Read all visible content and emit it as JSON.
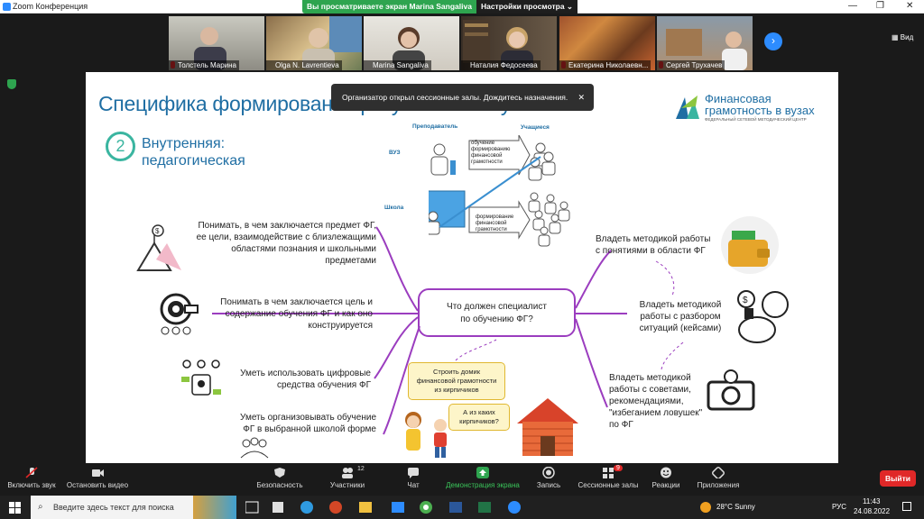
{
  "window": {
    "title": "Zoom Конференция"
  },
  "share_banner": {
    "message": "Вы просматриваете экран Marina Sangaliva",
    "options_label": "Настройки просмотра ⌄"
  },
  "gallery": {
    "participants": [
      {
        "name": "Толстель Марина",
        "muted": true
      },
      {
        "name": "Olga N. Lavrentieva",
        "muted": false
      },
      {
        "name": "Marina Sangaliva",
        "muted": false
      },
      {
        "name": "Наталия Федосеева",
        "muted": false
      },
      {
        "name": "Екатерина Николаевн...",
        "muted": true
      },
      {
        "name": "Сергей Трухачев",
        "muted": true
      }
    ],
    "view_label": "Вид"
  },
  "notification": {
    "text": "Организатор открыл сессионные залы. Дождитесь назначения."
  },
  "slide": {
    "title": "Специфика формирования результатов обучения",
    "logo": {
      "line1": "Финансовая",
      "line2": "грамотность в вузах",
      "line3": "ФЕДЕРАЛЬНЫЙ СЕТЕВОЙ МЕТОДИЧЕСКИЙ ЦЕНТР"
    },
    "section_number": "2",
    "section_title_1": "Внутренняя:",
    "section_title_2": "педагогическая",
    "diagram": {
      "teacher_label": "Преподаватель",
      "students_label": "Учащиеся",
      "vuz_label": "ВУЗ",
      "school_label": "Школа",
      "vuz_arrow_text": [
        "обучение",
        "формированию",
        "финансовой",
        "грамотности"
      ],
      "school_arrow_text": [
        "формирование",
        "финансовой",
        "грамотности"
      ]
    },
    "left_items": [
      [
        "Понимать, в чем заключается предмет ФГ,",
        "ее цели, взаимодействие с близлежащими",
        "областями познания и школьными",
        "предметами"
      ],
      [
        "Понимать в чем заключается цель и",
        "содержание обучения ФГ и как оно",
        "конструируется"
      ],
      [
        "Уметь использовать цифровые",
        "средства обучения ФГ"
      ],
      [
        "Уметь организовывать обучение",
        "ФГ в выбранной школой форме"
      ]
    ],
    "center_node": [
      "Что должен специалист",
      "по обучению ФГ?"
    ],
    "right_items": [
      [
        "Владеть методикой работы",
        "с понятиями в области ФГ"
      ],
      [
        "Владеть методикой",
        "работы с разбором",
        "ситуаций (кейсами)"
      ],
      [
        "Владеть методикой",
        "работы с советами,",
        "рекомендациями,",
        "\"избеганием ловушек\"",
        "по ФГ"
      ]
    ],
    "bubble1": [
      "Строить домик",
      "финансовой грамотности",
      "из кирпичиков"
    ],
    "bubble2": [
      "А из каких",
      "кирпичиков?"
    ]
  },
  "toolbar": {
    "mute": "Включить звук",
    "video": "Остановить видео",
    "security": "Безопасность",
    "participants": "Участники",
    "participants_count": "12",
    "chat": "Чат",
    "share": "Демонстрация экрана",
    "record": "Запись",
    "breakout": "Сессионные залы",
    "breakout_badge": "9",
    "reactions": "Реакции",
    "apps": "Приложения",
    "exit": "Выйти"
  },
  "taskbar": {
    "search_placeholder": "Введите здесь текст для поиска",
    "weather": "28°C  Sunny",
    "lang": "РУС",
    "time": "11:43",
    "date": "24.08.2022"
  },
  "colors": {
    "accent": "#2d8cff",
    "share_green": "#2ea44f",
    "exit_red": "#e02828",
    "slide_blue": "#1f6ea3",
    "mindmap_purple": "#9b3dbf",
    "teal": "#3ab5a0"
  }
}
